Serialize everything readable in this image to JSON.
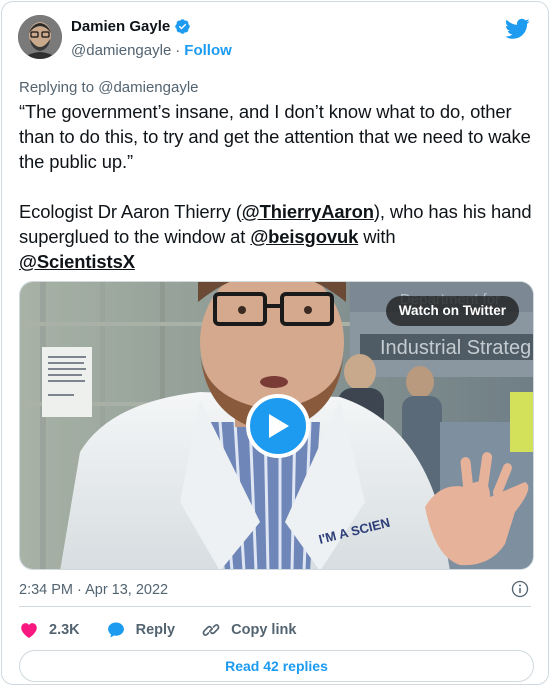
{
  "author": {
    "display_name": "Damien Gayle",
    "handle": "@damiengayle",
    "separator": "·",
    "follow_label": "Follow",
    "verified": true,
    "avatar_icon": "avatar-photo"
  },
  "reply_context": {
    "prefix": "Replying to",
    "handle": "@damiengayle"
  },
  "tweet": {
    "quote": "“The government’s insane, and I don’t know what to do, other than to do this, to try and get the attention that we need to wake the public up.”",
    "line_prefix": "Ecologist Dr Aaron Thierry (",
    "mention_1": "@ThierryAaron",
    "line_middle": "), who has his hand superglued to the window at ",
    "mention_2": "@beisgovuk",
    "line_with": " with",
    "mention_3": "@ScientistsX"
  },
  "media": {
    "watch_label": "Watch on Twitter",
    "play_icon": "play-icon",
    "bg_sign_text": "Department for Industrial Strategy"
  },
  "meta": {
    "timestamp": "2:34 PM · Apr 13, 2022"
  },
  "actions": {
    "like_count": "2.3K",
    "reply_label": "Reply",
    "copy_link_label": "Copy link"
  },
  "footer": {
    "read_replies_label": "Read 42 replies"
  },
  "colors": {
    "accent": "#1d9bf0",
    "like_red": "#f91880",
    "text_primary": "#0f1419",
    "text_secondary": "#536471",
    "border": "#cfd9de"
  }
}
